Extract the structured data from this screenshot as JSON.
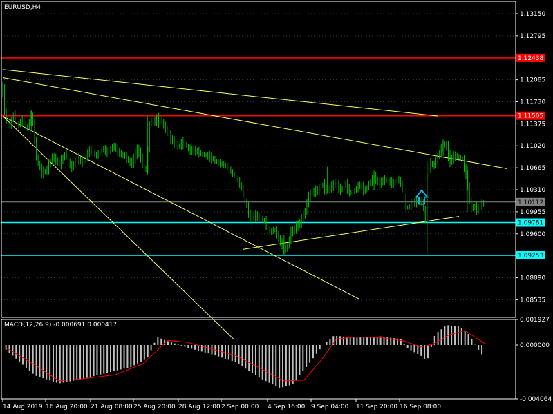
{
  "symbol_label": "EURUSD,H4",
  "indicator_label": "MACD(12,26,9) -0.000691 0.000417",
  "colors": {
    "background": "#000000",
    "frame": "#ffffff",
    "grid": "#3a3a3a",
    "candle": "#00c000",
    "resistance": "#ff0000",
    "support": "#00ffff",
    "trendline": "#ffff66",
    "current_price": "#8c8c8c",
    "macd_hist": "#c0c0c0",
    "macd_signal": "#ff0000",
    "arrow": "#00bfff"
  },
  "chart_data": [
    {
      "type": "candlestick",
      "title": "EURUSD,H4",
      "x_ticks": [
        "14 Aug 2019",
        "16 Aug 20:00",
        "21 Aug 08:00",
        "25 Aug 20:00",
        "28 Aug 12:00",
        "2 Sep 00:00",
        "4 Sep 16:00",
        "9 Sep 04:00",
        "11 Sep 20:00",
        "16 Sep 08:00"
      ],
      "y_ticks": [
        "1.13150",
        "1.12795",
        "1.12085",
        "1.11730",
        "1.11375",
        "1.11020",
        "1.10665",
        "1.10310",
        "1.09955",
        "1.09600",
        "1.08890",
        "1.08535"
      ],
      "ylim": [
        1.0825,
        1.1335
      ],
      "horizontal_levels": [
        {
          "label": "1.12438",
          "value": 1.12438,
          "kind": "resistance"
        },
        {
          "label": "1.11505",
          "value": 1.11505,
          "kind": "resistance"
        },
        {
          "label": "1.10112",
          "value": 1.10112,
          "kind": "current_price"
        },
        {
          "label": "1.09781",
          "value": 1.09781,
          "kind": "support"
        },
        {
          "label": "1.09253",
          "value": 1.09253,
          "kind": "support"
        }
      ],
      "price_path": [
        [
          0,
          1.1195
        ],
        [
          3,
          1.1145
        ],
        [
          8,
          1.1132
        ],
        [
          14,
          1.1155
        ],
        [
          18,
          1.1133
        ],
        [
          24,
          1.1145
        ],
        [
          30,
          1.1128
        ],
        [
          36,
          1.1155
        ],
        [
          42,
          1.1082
        ],
        [
          48,
          1.1058
        ],
        [
          54,
          1.1062
        ],
        [
          62,
          1.1085
        ],
        [
          70,
          1.1072
        ],
        [
          78,
          1.109
        ],
        [
          85,
          1.1065
        ],
        [
          92,
          1.1082
        ],
        [
          100,
          1.1075
        ],
        [
          108,
          1.1096
        ],
        [
          116,
          1.1085
        ],
        [
          124,
          1.1098
        ],
        [
          130,
          1.1091
        ],
        [
          138,
          1.1102
        ],
        [
          145,
          1.109
        ],
        [
          152,
          1.1085
        ],
        [
          160,
          1.1072
        ],
        [
          168,
          1.1098
        ],
        [
          174,
          1.1072
        ],
        [
          178,
          1.106
        ],
        [
          180,
          1.1088
        ],
        [
          183,
          1.1145
        ],
        [
          188,
          1.114
        ],
        [
          194,
          1.115
        ],
        [
          200,
          1.1135
        ],
        [
          206,
          1.112
        ],
        [
          212,
          1.1108
        ],
        [
          218,
          1.11
        ],
        [
          225,
          1.1108
        ],
        [
          232,
          1.1095
        ],
        [
          240,
          1.1094
        ],
        [
          248,
          1.1088
        ],
        [
          256,
          1.1085
        ],
        [
          264,
          1.1078
        ],
        [
          272,
          1.1072
        ],
        [
          280,
          1.1068
        ],
        [
          286,
          1.1056
        ],
        [
          292,
          1.1048
        ],
        [
          298,
          1.103
        ],
        [
          304,
          1.1002
        ],
        [
          308,
          1.0982
        ],
        [
          314,
          1.099
        ],
        [
          320,
          1.0985
        ],
        [
          326,
          1.098
        ],
        [
          332,
          1.0962
        ],
        [
          338,
          1.0968
        ],
        [
          344,
          1.095
        ],
        [
          350,
          1.0935
        ],
        [
          354,
          1.0938
        ],
        [
          358,
          1.0962
        ],
        [
          364,
          1.097
        ],
        [
          370,
          1.0978
        ],
        [
          376,
          1.0995
        ],
        [
          380,
          1.102
        ],
        [
          386,
          1.1028
        ],
        [
          392,
          1.103
        ],
        [
          398,
          1.104
        ],
        [
          402,
          1.1028
        ],
        [
          408,
          1.1035
        ],
        [
          414,
          1.1042
        ],
        [
          420,
          1.103
        ],
        [
          426,
          1.1042
        ],
        [
          432,
          1.1025
        ],
        [
          438,
          1.103
        ],
        [
          444,
          1.104
        ],
        [
          450,
          1.1028
        ],
        [
          456,
          1.1042
        ],
        [
          462,
          1.1052
        ],
        [
          468,
          1.104
        ],
        [
          474,
          1.1048
        ],
        [
          480,
          1.1045
        ],
        [
          486,
          1.104
        ],
        [
          492,
          1.105
        ],
        [
          498,
          1.103
        ],
        [
          502,
          1.1
        ],
        [
          508,
          1.1008
        ],
        [
          514,
          1.1012
        ],
        [
          520,
          1.1015
        ],
        [
          524,
          1.1
        ],
        [
          526,
          1.0978
        ],
        [
          528,
          1.1055
        ],
        [
          532,
          1.1075
        ],
        [
          536,
          1.1068
        ],
        [
          540,
          1.1082
        ],
        [
          544,
          1.1092
        ],
        [
          548,
          1.1105
        ],
        [
          552,
          1.1102
        ],
        [
          556,
          1.1075
        ],
        [
          560,
          1.1085
        ],
        [
          566,
          1.1085
        ],
        [
          572,
          1.108
        ],
        [
          578,
          1.1045
        ],
        [
          582,
          1.1
        ],
        [
          586,
          1.1005
        ],
        [
          590,
          1.0998
        ],
        [
          596,
          1.1008
        ],
        [
          600,
          1.1011
        ]
      ],
      "wicks": [
        [
          0,
          1.1205,
          1.118
        ],
        [
          36,
          1.116,
          1.1125
        ],
        [
          180,
          1.115,
          1.1055
        ],
        [
          194,
          1.1155,
          1.113
        ],
        [
          310,
          1.1,
          1.0965
        ],
        [
          350,
          1.0958,
          1.0925
        ],
        [
          404,
          1.1068,
          1.1025
        ],
        [
          462,
          1.1062,
          1.103
        ],
        [
          528,
          1.1078,
          1.0928
        ],
        [
          548,
          1.1112,
          1.1085
        ],
        [
          578,
          1.107,
          1.0995
        ]
      ],
      "trendlines": [
        {
          "from": [
            "14 Aug 2019",
            1.1225
          ],
          "to": [
            "16 Sep 20:00",
            1.115
          ]
        },
        {
          "from": [
            "14 Aug 2019",
            1.1212
          ],
          "to": [
            "17 Sep 12:00",
            1.1065
          ]
        },
        {
          "from": [
            "14 Aug 2019",
            1.115
          ],
          "to": [
            "13 Sep 04:00",
            1.0855
          ]
        },
        {
          "from": [
            "14 Aug 2019",
            1.115
          ],
          "to": [
            "30 Aug 08:00",
            1.079
          ]
        },
        {
          "from": [
            "3 Sep 00:00",
            1.0935
          ],
          "to": [
            "17 Sep 04:00",
            1.0988
          ]
        }
      ],
      "arrow": {
        "direction": "up",
        "at": "16 Sep 20:00",
        "value": 1.1008
      }
    },
    {
      "type": "bar",
      "title": "MACD(12,26,9) -0.000691 0.000417",
      "y_ticks": [
        "0.001927",
        "0.000000",
        "-0.004064"
      ],
      "ylim": [
        -0.004064,
        0.001927
      ],
      "histogram": [
        [
          4,
          -0.00035
        ],
        [
          40,
          -0.0023
        ],
        [
          70,
          -0.0029
        ],
        [
          100,
          -0.00255
        ],
        [
          130,
          -0.0021
        ],
        [
          160,
          -0.00165
        ],
        [
          180,
          -0.001
        ],
        [
          192,
          0.0006
        ],
        [
          205,
          0.0003
        ],
        [
          230,
          -0.0002
        ],
        [
          260,
          -0.0007
        ],
        [
          290,
          -0.0013
        ],
        [
          320,
          -0.0025
        ],
        [
          345,
          -0.00325
        ],
        [
          360,
          -0.003
        ],
        [
          380,
          -0.0015
        ],
        [
          398,
          -5e-05
        ],
        [
          412,
          0.0007
        ],
        [
          440,
          0.00055
        ],
        [
          470,
          0.00065
        ],
        [
          495,
          0.00045
        ],
        [
          505,
          -0.0003
        ],
        [
          520,
          -0.0008
        ],
        [
          528,
          -0.0012
        ],
        [
          538,
          0.0008
        ],
        [
          552,
          0.0015
        ],
        [
          568,
          0.0014
        ],
        [
          580,
          0.0008
        ],
        [
          590,
          -0.0002
        ],
        [
          598,
          -0.00085
        ]
      ],
      "signal": [
        [
          4,
          -0.0002
        ],
        [
          40,
          -0.0015
        ],
        [
          70,
          -0.0027
        ],
        [
          100,
          -0.00255
        ],
        [
          140,
          -0.00225
        ],
        [
          175,
          -0.0014
        ],
        [
          205,
          0.00035
        ],
        [
          230,
          0.0002
        ],
        [
          260,
          -0.0003
        ],
        [
          290,
          -0.0008
        ],
        [
          320,
          -0.00175
        ],
        [
          350,
          -0.0027
        ],
        [
          375,
          -0.00265
        ],
        [
          398,
          -0.001
        ],
        [
          415,
          0.00045
        ],
        [
          440,
          0.0006
        ],
        [
          470,
          0.00055
        ],
        [
          500,
          0.0003
        ],
        [
          520,
          -0.00015
        ],
        [
          535,
          5e-05
        ],
        [
          555,
          0.00075
        ],
        [
          575,
          0.0011
        ],
        [
          600,
          0.0001
        ]
      ]
    }
  ]
}
